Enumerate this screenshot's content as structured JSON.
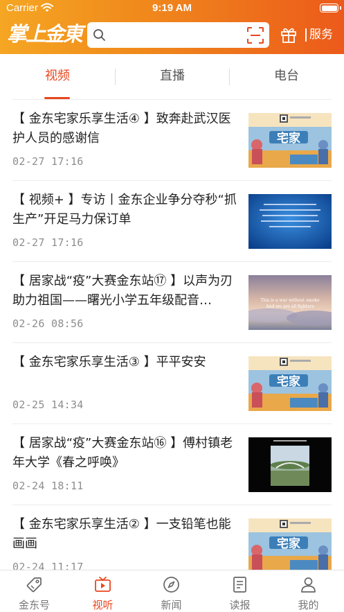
{
  "status_bar": {
    "carrier": "Carrier",
    "time": "9:19 AM"
  },
  "header": {
    "logo_text": "掌上金東",
    "search": {
      "placeholder": ""
    },
    "service_label": "服务",
    "brand_colors": {
      "start": "#f5a623",
      "end": "#ec5a1b"
    }
  },
  "tabs": [
    {
      "label": "视频",
      "active": true
    },
    {
      "label": "直播",
      "active": false
    },
    {
      "label": "电台",
      "active": false
    }
  ],
  "news": [
    {
      "title": "【 金东宅家乐享生活④ 】致奔赴武汉医护人员的感谢信",
      "time": "02-27  17:16",
      "thumb": "poster-zhaijia"
    },
    {
      "title": "【 视频+ 】专访丨金东企业争分夺秒“抓生产”开足马力保订单",
      "time": "02-27  17:16",
      "thumb": "blue-text-slide"
    },
    {
      "title": "【 居家战“疫”大赛金东站⑰ 】以声为刃助力祖国——曙光小学五年级配音…",
      "time": "02-26  08:56",
      "thumb": "sunset-clouds",
      "thumb_text": {
        "line1": "This is a war without smoke",
        "line2": "And we are all fighters"
      }
    },
    {
      "title": "【 金东宅家乐享生活③ 】平平安安",
      "time": "02-25  14:34",
      "thumb": "poster-zhaijia"
    },
    {
      "title": "【 居家战“疫”大赛金东站⑯ 】傅村镇老年大学《春之呼唤》",
      "time": "02-24  18:11",
      "thumb": "bridge-photo"
    },
    {
      "title": "【 金东宅家乐享生活② 】一支铅笔也能画画",
      "time": "02-24  11:17",
      "thumb": "poster-zhaijia"
    }
  ],
  "poster_text": "宅家",
  "bottom_nav": [
    {
      "label": "金东号",
      "icon": "tag-icon",
      "active": false
    },
    {
      "label": "视听",
      "icon": "tv-play-icon",
      "active": true
    },
    {
      "label": "新闻",
      "icon": "compass-icon",
      "active": false
    },
    {
      "label": "读报",
      "icon": "newspaper-icon",
      "active": false
    },
    {
      "label": "我的",
      "icon": "user-icon",
      "active": false
    }
  ],
  "accent_color": "#e8461e"
}
